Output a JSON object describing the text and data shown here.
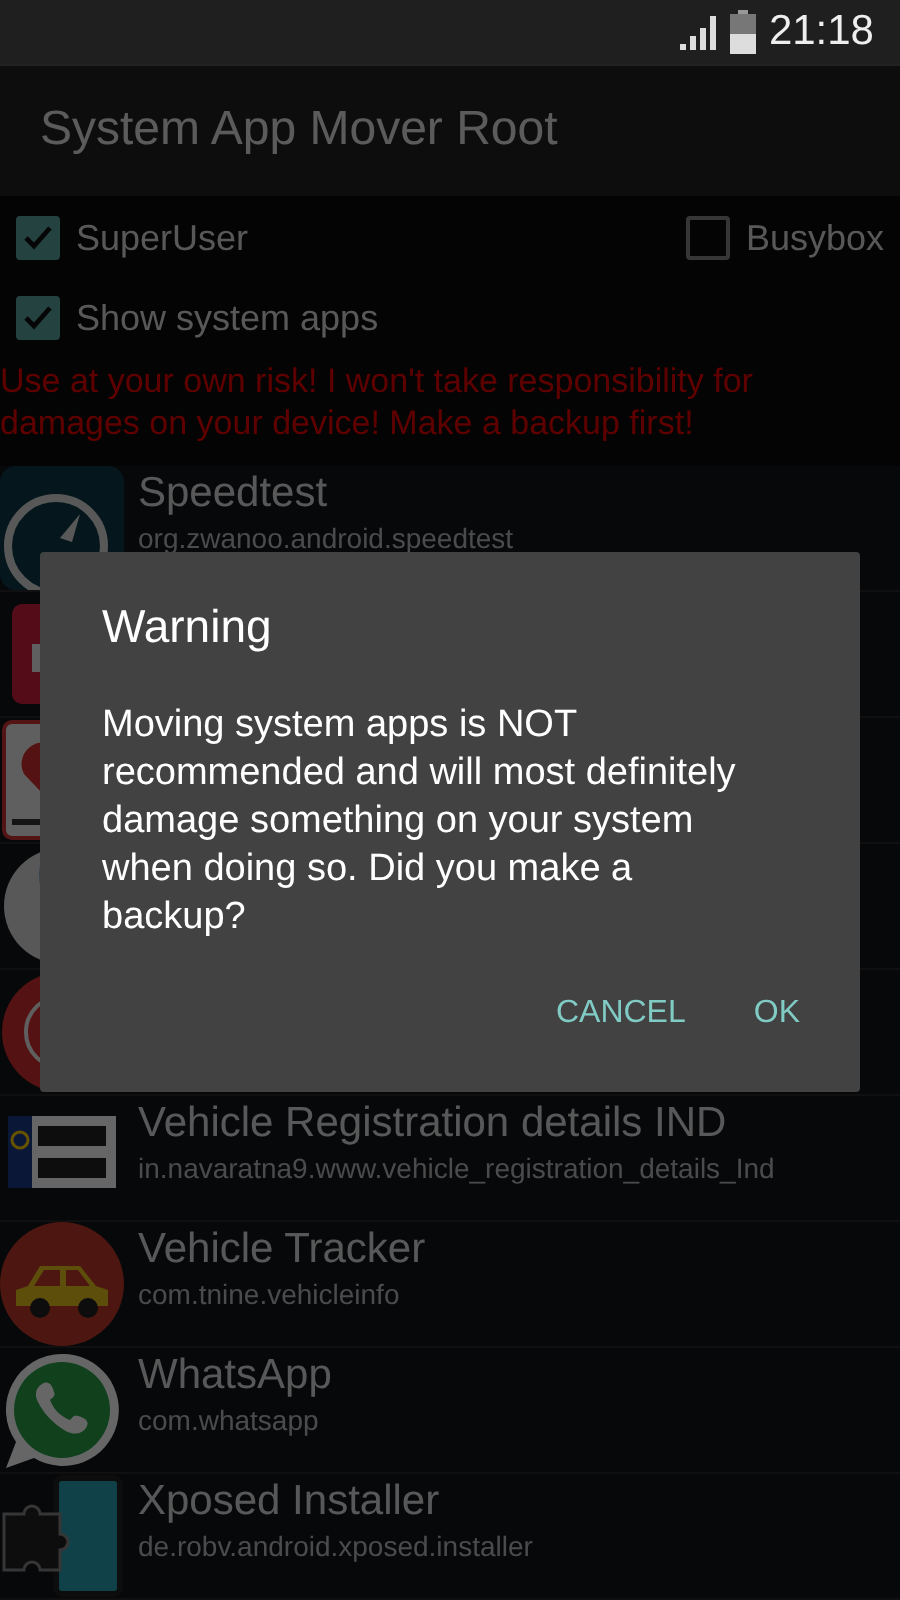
{
  "status_bar": {
    "time": "21:18"
  },
  "action_bar": {
    "title": "System App Mover Root"
  },
  "options": [
    {
      "label": "SuperUser",
      "checked": true
    },
    {
      "label": "Busybox",
      "checked": false
    },
    {
      "label": "Show system apps",
      "checked": true
    }
  ],
  "risk_notice": "Use at your own risk! I won't take responsibility for damages on your device! Make a backup first!",
  "apps": [
    {
      "kind": "app",
      "name": "Speedtest",
      "package": "org.zwanoo.android.speedtest"
    },
    {
      "kind": "covered"
    },
    {
      "kind": "covered"
    },
    {
      "kind": "covered"
    },
    {
      "kind": "covered"
    },
    {
      "kind": "app",
      "name": "Vehicle Registration details IND",
      "package": "in.navaratna9.www.vehicle_registration_details_Ind"
    },
    {
      "kind": "app",
      "name": "Vehicle Tracker",
      "package": "com.tnine.vehicleinfo"
    },
    {
      "kind": "app",
      "name": "WhatsApp",
      "package": "com.whatsapp"
    },
    {
      "kind": "app",
      "name": "Xposed Installer",
      "package": "de.robv.android.xposed.installer"
    }
  ],
  "dialog": {
    "title": "Warning",
    "message": "Moving system apps is NOT recommended and will most definitely damage something on your system when doing so. Did you make a backup?",
    "buttons": [
      "CANCEL",
      "OK"
    ]
  }
}
